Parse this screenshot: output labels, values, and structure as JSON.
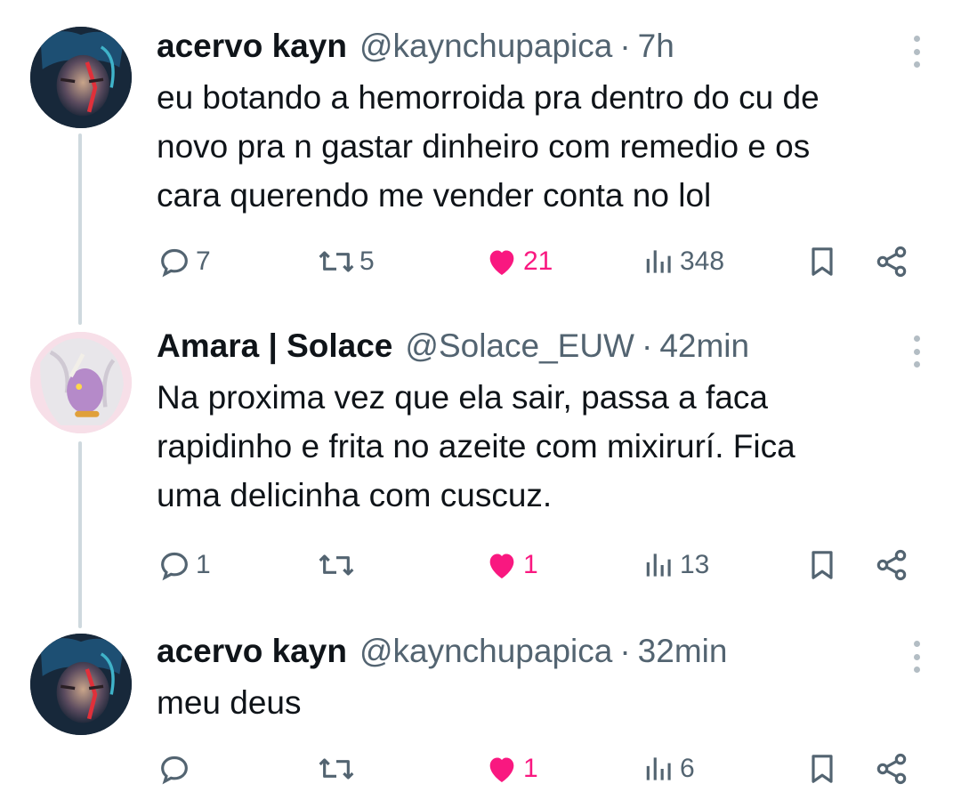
{
  "colors": {
    "accent_like": "#f91880",
    "muted": "#536471",
    "thread_line": "#cfd9de"
  },
  "tweets": [
    {
      "name": "acervo kayn",
      "handle": "@kaynchupapica",
      "dot": "·",
      "time": "7h",
      "text": "eu botando a hemorroida pra dentro do cu de\nnovo pra n gastar dinheiro com remedio e os\ncara querendo me vender conta no lol",
      "replies": "7",
      "retweets": "5",
      "likes": "21",
      "views": "348",
      "liked": true
    },
    {
      "name": "Amara | Solace",
      "handle": "@Solace_EUW",
      "dot": "·",
      "time": "42min",
      "text": "Na proxima vez que ela sair, passa a faca\nrapidinho e frita no azeite com mixirurí. Fica\numa delicinha com cuscuz.",
      "replies": "1",
      "retweets": "",
      "likes": "1",
      "views": "13",
      "liked": true
    },
    {
      "name": "acervo kayn",
      "handle": "@kaynchupapica",
      "dot": "·",
      "time": "32min",
      "text": "meu deus",
      "replies": "",
      "retweets": "",
      "likes": "1",
      "views": "6",
      "liked": true
    }
  ]
}
